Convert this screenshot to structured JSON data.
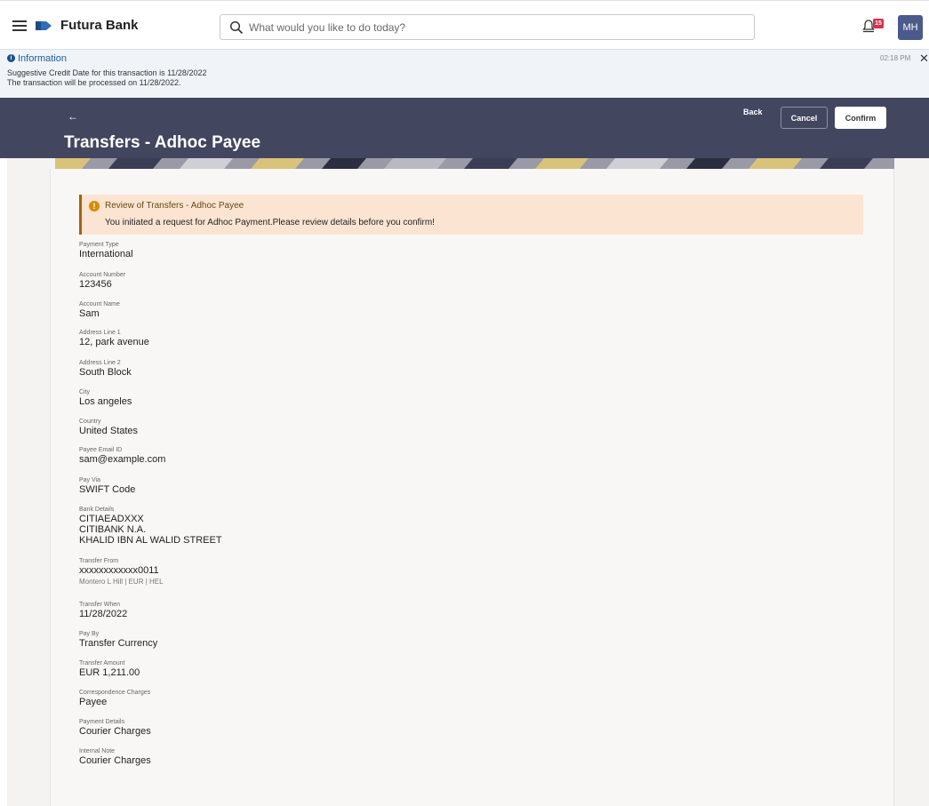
{
  "app": {
    "brand": "Futura Bank",
    "search_placeholder": "What would you like to do today?",
    "notification_count": "15",
    "avatar_initials": "MH"
  },
  "info_banner": {
    "title": "Information",
    "line1": "Suggestive Credit Date for this transaction is 11/28/2022",
    "line2": "The transaction will be processed on 11/28/2022.",
    "time": "02:18 PM"
  },
  "header": {
    "title": "Transfers - Adhoc Payee",
    "back_label": "Back",
    "cancel_label": "Cancel",
    "confirm_label": "Confirm"
  },
  "review": {
    "title": "Review of Transfers - Adhoc Payee",
    "message": "You initiated a request for Adhoc Payment.Please review details before you confirm!"
  },
  "fields": {
    "payment_type": {
      "label": "Payment Type",
      "value": "International"
    },
    "account_number": {
      "label": "Account Number",
      "value": "123456"
    },
    "account_name": {
      "label": "Account Name",
      "value": "Sam"
    },
    "address_line_1": {
      "label": "Address Line 1",
      "value": "12, park avenue"
    },
    "address_line_2": {
      "label": "Address Line 2",
      "value": "South Block"
    },
    "city": {
      "label": "City",
      "value": "Los angeles"
    },
    "country": {
      "label": "Country",
      "value": "United States"
    },
    "payee_email": {
      "label": "Payee Email ID",
      "value": "sam@example.com"
    },
    "pay_via": {
      "label": "Pay Via",
      "value": "SWIFT Code"
    },
    "bank_details": {
      "label": "Bank Details",
      "line1": "CITIAEADXXX",
      "line2": "CITIBANK N.A.",
      "line3": "KHALID IBN AL WALID STREET"
    },
    "transfer_from": {
      "label": "Transfer From",
      "value": "xxxxxxxxxxxx0011",
      "sub": "Montero L Hill | EUR | HEL"
    },
    "transfer_when": {
      "label": "Transfer When",
      "value": "11/28/2022"
    },
    "pay_by": {
      "label": "Pay By",
      "value": "Transfer Currency"
    },
    "transfer_amount": {
      "label": "Transfer Amount",
      "value": "EUR 1,211.00"
    },
    "correspondence_charges": {
      "label": "Correspondence Charges",
      "value": "Payee"
    },
    "payment_details": {
      "label": "Payment Details",
      "value": "Courier Charges"
    },
    "internal_note": {
      "label": "Internal Note",
      "value": "Courier Charges"
    }
  },
  "colors": {
    "header_bg": "#43465f",
    "info_bg": "#f0f4f9",
    "review_bg": "#fbe5d2",
    "review_border": "#a2640d",
    "badge": "#d6314a"
  }
}
